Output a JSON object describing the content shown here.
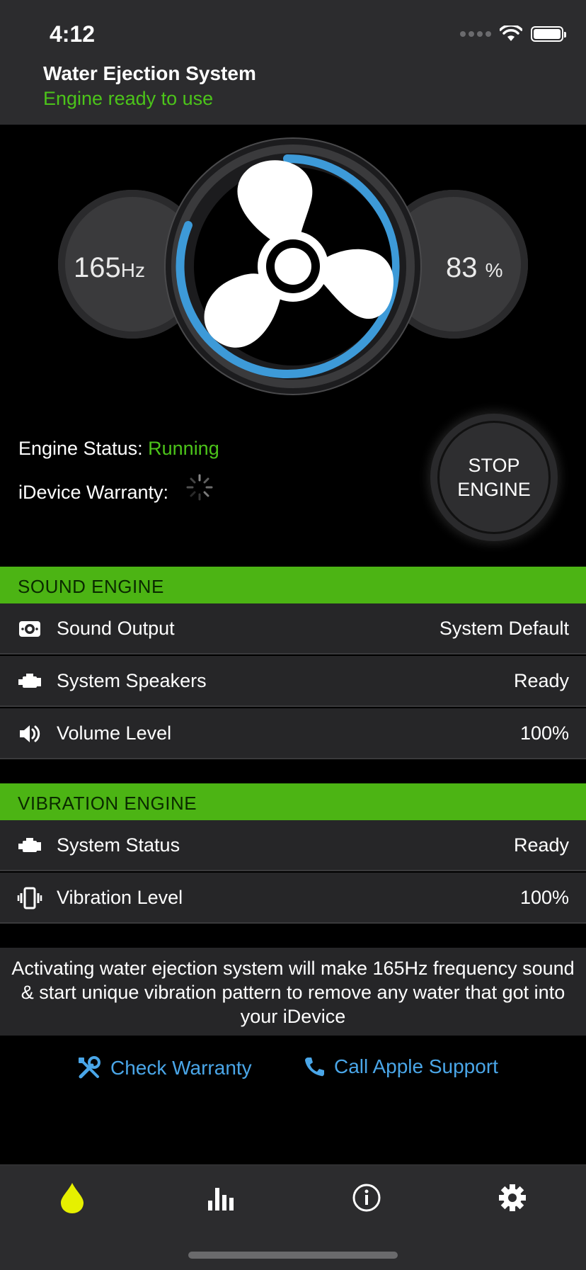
{
  "status_bar": {
    "time": "4:12"
  },
  "header": {
    "title": "Water Ejection System",
    "subtitle": "Engine ready to use"
  },
  "gauge": {
    "frequency_value": "165",
    "frequency_unit": "Hz",
    "percent_value": "83",
    "percent_unit": "%"
  },
  "status": {
    "engine_label": "Engine Status:",
    "engine_value": "Running",
    "warranty_label": "iDevice Warranty:"
  },
  "stop_button": {
    "line1": "STOP",
    "line2": "ENGINE"
  },
  "sound_engine": {
    "header": "SOUND ENGINE",
    "rows": [
      {
        "icon": "speaker-box-icon",
        "label": "Sound Output",
        "value": "System Default"
      },
      {
        "icon": "engine-icon",
        "label": "System Speakers",
        "value": "Ready"
      },
      {
        "icon": "volume-icon",
        "label": "Volume Level",
        "value": "100%"
      }
    ]
  },
  "vibration_engine": {
    "header": "VIBRATION ENGINE",
    "rows": [
      {
        "icon": "engine-icon",
        "label": "System Status",
        "value": "Ready"
      },
      {
        "icon": "vibration-icon",
        "label": "Vibration Level",
        "value": "100%"
      }
    ]
  },
  "info_text": "Activating water ejection system will make 165Hz frequency sound & start unique vibration pattern to remove any water that got into your iDevice",
  "links": {
    "check_warranty": "Check Warranty",
    "call_support": "Call Apple Support"
  },
  "tabs": [
    {
      "icon": "water-drop-icon",
      "active": true
    },
    {
      "icon": "bar-chart-icon",
      "active": false
    },
    {
      "icon": "info-icon",
      "active": false
    },
    {
      "icon": "gear-icon",
      "active": false
    }
  ],
  "colors": {
    "accent_green": "#4cb414",
    "status_green": "#4cc41a",
    "link_blue": "#4aa6e8",
    "ring_blue": "#3d9ad8",
    "active_tab": "#e6f000"
  }
}
